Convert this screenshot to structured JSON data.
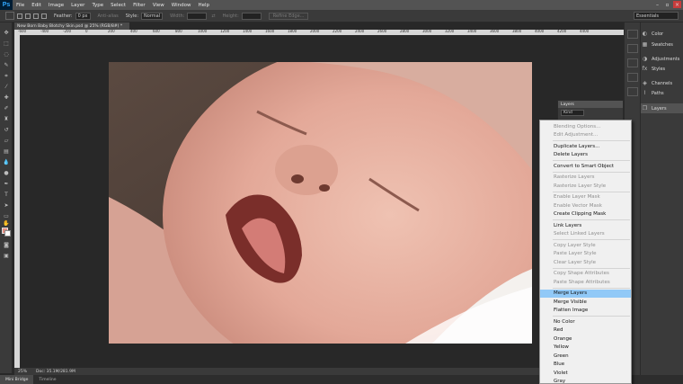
{
  "app": {
    "logo": "Ps"
  },
  "menubar": {
    "items": [
      "File",
      "Edit",
      "Image",
      "Layer",
      "Type",
      "Select",
      "Filter",
      "View",
      "Window",
      "Help"
    ]
  },
  "window_controls": {
    "minimize": "–",
    "restore": "▫",
    "close": "×"
  },
  "optionsbar": {
    "feather_label": "Feather:",
    "feather_value": "0 px",
    "antialias_label": "Anti-alias",
    "style_label": "Style:",
    "style_value": "Normal",
    "width_label": "Width:",
    "height_label": "Height:",
    "refine_label": "Refine Edge...",
    "workspace": "Essentials"
  },
  "document": {
    "tab_title": "New Born Baby Blotchy Skin.psd @ 25% (RGB/8#) *",
    "ruler_ticks": [
      "-600",
      "-400",
      "-200",
      "0",
      "200",
      "400",
      "600",
      "800",
      "1000",
      "1200",
      "1400",
      "1600",
      "1800",
      "2000",
      "2200",
      "2400",
      "2600",
      "2800",
      "3000",
      "3200",
      "3400",
      "3600",
      "3800",
      "4000",
      "4200",
      "4400"
    ]
  },
  "statusbar": {
    "zoom": "25%",
    "doc_info": "Doc: 35.1M/281.9M"
  },
  "bottom_tabs": [
    "Mini Bridge",
    "Timeline"
  ],
  "dock": {
    "items": [
      "Color",
      "Swatches",
      "Adjustments",
      "Styles",
      "Channels",
      "Paths",
      "Layers"
    ]
  },
  "layers_panel": {
    "title": "Layers",
    "kind": "Kind"
  },
  "context_menu": {
    "groups": [
      [
        {
          "label": "Blending Options...",
          "enabled": false
        },
        {
          "label": "Edit Adjustment...",
          "enabled": false
        }
      ],
      [
        {
          "label": "Duplicate Layers...",
          "enabled": true
        },
        {
          "label": "Delete Layers",
          "enabled": true
        }
      ],
      [
        {
          "label": "Convert to Smart Object",
          "enabled": true
        }
      ],
      [
        {
          "label": "Rasterize Layers",
          "enabled": false
        },
        {
          "label": "Rasterize Layer Style",
          "enabled": false
        }
      ],
      [
        {
          "label": "Enable Layer Mask",
          "enabled": false
        },
        {
          "label": "Enable Vector Mask",
          "enabled": false
        },
        {
          "label": "Create Clipping Mask",
          "enabled": true
        }
      ],
      [
        {
          "label": "Link Layers",
          "enabled": true
        },
        {
          "label": "Select Linked Layers",
          "enabled": false
        }
      ],
      [
        {
          "label": "Copy Layer Style",
          "enabled": false
        },
        {
          "label": "Paste Layer Style",
          "enabled": false
        },
        {
          "label": "Clear Layer Style",
          "enabled": false
        }
      ],
      [
        {
          "label": "Copy Shape Attributes",
          "enabled": false
        },
        {
          "label": "Paste Shape Attributes",
          "enabled": false
        }
      ],
      [
        {
          "label": "Merge Layers",
          "enabled": true,
          "highlighted": true
        },
        {
          "label": "Merge Visible",
          "enabled": true
        },
        {
          "label": "Flatten Image",
          "enabled": true
        }
      ],
      [
        {
          "label": "No Color",
          "enabled": true
        },
        {
          "label": "Red",
          "enabled": true
        },
        {
          "label": "Orange",
          "enabled": true
        },
        {
          "label": "Yellow",
          "enabled": true
        },
        {
          "label": "Green",
          "enabled": true
        },
        {
          "label": "Blue",
          "enabled": true
        },
        {
          "label": "Violet",
          "enabled": true
        },
        {
          "label": "Gray",
          "enabled": true
        }
      ]
    ]
  },
  "colors": {
    "foreground": "#e58f82",
    "background": "#ffffff",
    "menu_highlight": "#91c9f7"
  }
}
